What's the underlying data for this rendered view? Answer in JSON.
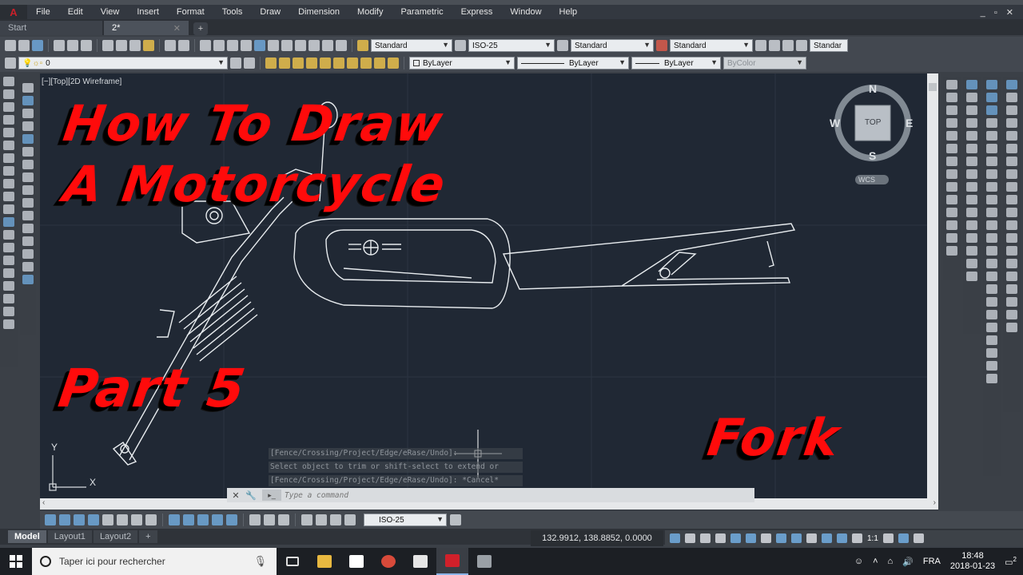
{
  "app": {
    "menu": [
      "File",
      "Edit",
      "View",
      "Insert",
      "Format",
      "Tools",
      "Draw",
      "Dimension",
      "Modify",
      "Parametric",
      "Express",
      "Window",
      "Help"
    ],
    "window_controls": "_ ▫ ✕"
  },
  "tabs": [
    {
      "label": "Start",
      "active": false
    },
    {
      "label": "2*",
      "active": true
    }
  ],
  "toolbar1": {
    "text_style": "Standard",
    "dim_style": "ISO-25",
    "table_style": "Standard",
    "mleader_style": "Standard",
    "extra_style": "Standar"
  },
  "toolbar2": {
    "layer": "0",
    "color": "ByLayer",
    "linetype": "ByLayer",
    "lineweight": "ByLayer",
    "plotstyle": "ByColor"
  },
  "viewport": {
    "label": "[−][Top][2D Wireframe]",
    "viewcube": {
      "top": "TOP",
      "n": "N",
      "s": "S",
      "e": "E",
      "w": "W",
      "ucs": "WCS"
    },
    "ucs_x": "X",
    "ucs_y": "Y"
  },
  "overlay": {
    "line1": "How To Draw",
    "line2": "A Motorcycle",
    "part": "Part 5",
    "subject": "Fork"
  },
  "command": {
    "history": [
      "[Fence/Crossing/Project/Edge/eRase/Undo]:",
      "Select object to trim or shift-select to extend or",
      "[Fence/Crossing/Project/Edge/eRase/Undo]: *Cancel*"
    ],
    "placeholder": "Type a command"
  },
  "status": {
    "dim_style": "ISO-25",
    "coordinates": "132.9912, 138.8852, 0.0000",
    "scale": "1:1"
  },
  "layouts": [
    {
      "label": "Model",
      "active": true
    },
    {
      "label": "Layout1",
      "active": false
    },
    {
      "label": "Layout2",
      "active": false
    }
  ],
  "taskbar": {
    "search_placeholder": "Taper ici pour rechercher",
    "language": "FRA",
    "time": "18:48",
    "date": "2018-01-23",
    "notification_count": "2"
  },
  "colors": {
    "viewport_bg": "#202834",
    "drawing_lines": "#e8ecef",
    "title_red": "#ff0b0b"
  }
}
